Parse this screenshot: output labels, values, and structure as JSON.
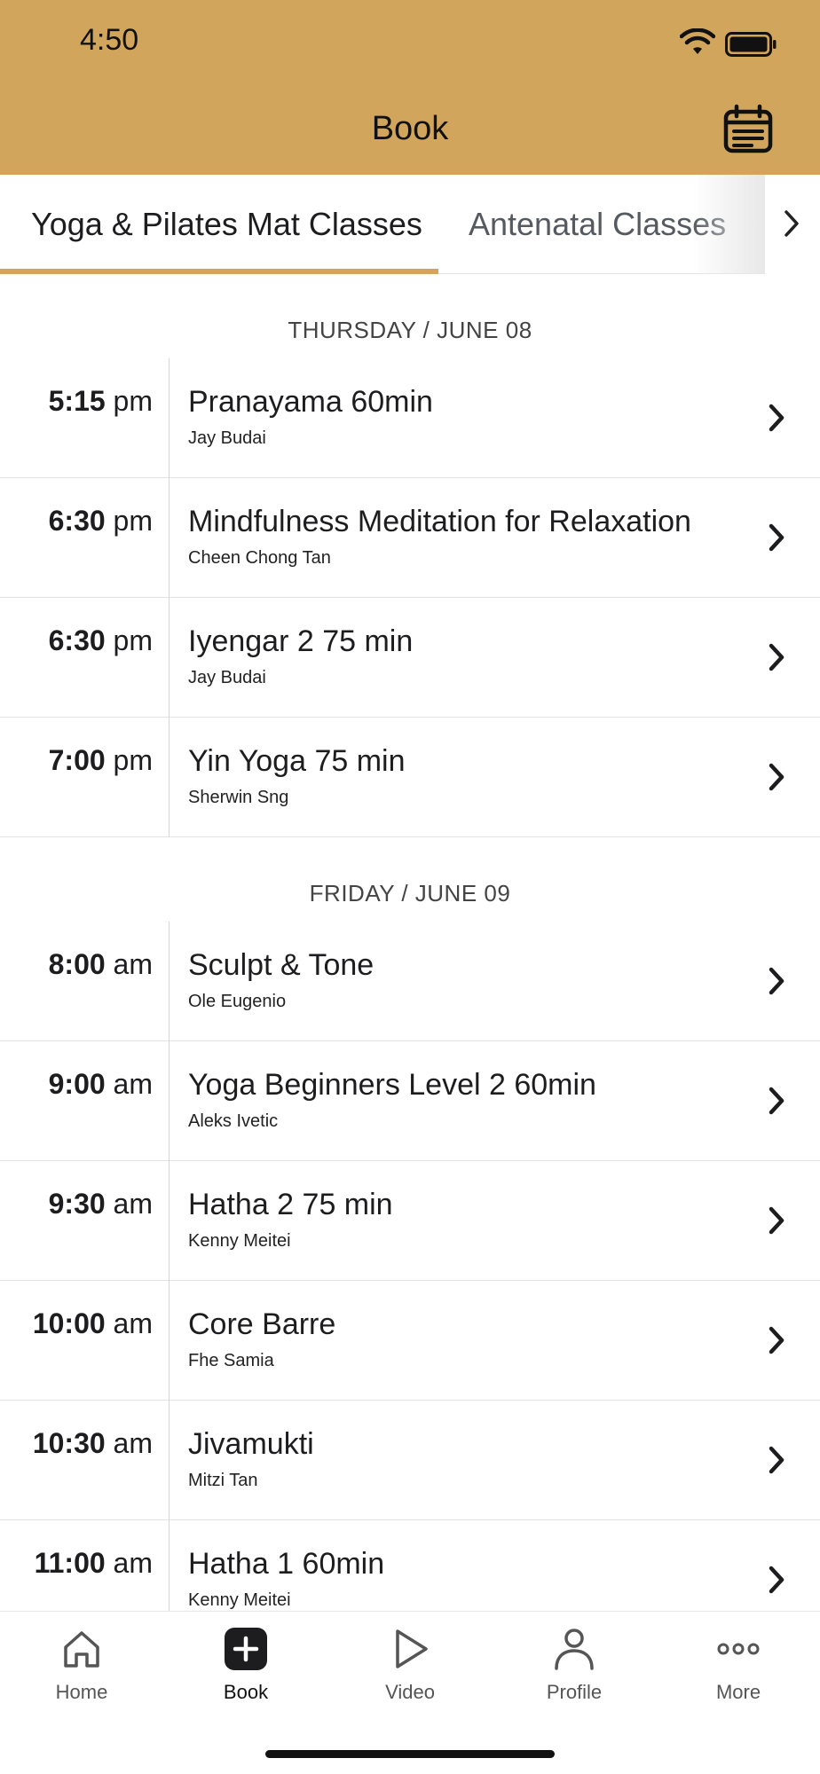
{
  "status_bar": {
    "time": "4:50"
  },
  "header": {
    "title": "Book"
  },
  "tabs": [
    {
      "label": "Yoga & Pilates Mat Classes",
      "active": true
    },
    {
      "label": "Antenatal Classes",
      "active": false
    }
  ],
  "days": [
    {
      "label": "THURSDAY / JUNE 08",
      "classes": [
        {
          "time": "5:15",
          "ampm": "pm",
          "name": "Pranayama 60min",
          "teacher": "Jay Budai"
        },
        {
          "time": "6:30",
          "ampm": "pm",
          "name": "Mindfulness Meditation for Relaxation",
          "teacher": "Cheen Chong Tan"
        },
        {
          "time": "6:30",
          "ampm": "pm",
          "name": "Iyengar 2 75 min",
          "teacher": "Jay Budai"
        },
        {
          "time": "7:00",
          "ampm": "pm",
          "name": "Yin Yoga 75 min",
          "teacher": "Sherwin Sng"
        }
      ]
    },
    {
      "label": "FRIDAY / JUNE 09",
      "classes": [
        {
          "time": "8:00",
          "ampm": "am",
          "name": "Sculpt & Tone",
          "teacher": "Ole Eugenio"
        },
        {
          "time": "9:00",
          "ampm": "am",
          "name": "Yoga Beginners Level 2 60min",
          "teacher": "Aleks Ivetic"
        },
        {
          "time": "9:30",
          "ampm": "am",
          "name": "Hatha 2 75 min",
          "teacher": "Kenny Meitei"
        },
        {
          "time": "10:00",
          "ampm": "am",
          "name": "Core Barre",
          "teacher": "Fhe Samia"
        },
        {
          "time": "10:30",
          "ampm": "am",
          "name": "Jivamukti",
          "teacher": "Mitzi Tan"
        },
        {
          "time": "11:00",
          "ampm": "am",
          "name": "Hatha 1 60min",
          "teacher": "Kenny Meitei"
        }
      ]
    }
  ],
  "bottom_nav": [
    {
      "label": "Home",
      "icon": "home-icon",
      "active": false
    },
    {
      "label": "Book",
      "icon": "plus-square-icon",
      "active": true
    },
    {
      "label": "Video",
      "icon": "play-icon",
      "active": false
    },
    {
      "label": "Profile",
      "icon": "person-icon",
      "active": false
    },
    {
      "label": "More",
      "icon": "more-dots-icon",
      "active": false
    }
  ],
  "colors": {
    "brand": "#d1a65c",
    "text": "#1d1d1f",
    "muted": "#555a60"
  }
}
